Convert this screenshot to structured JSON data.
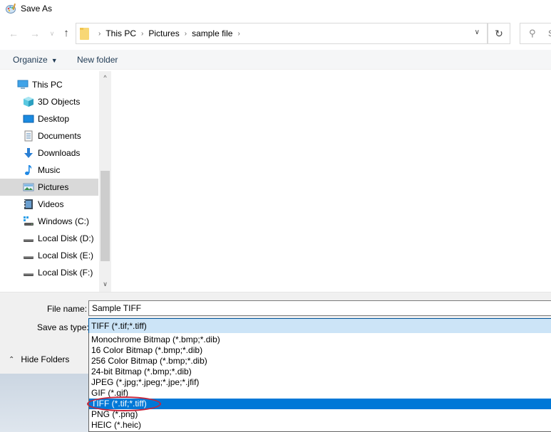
{
  "window": {
    "title": "Save As",
    "app_icon": "paint-palette-icon"
  },
  "navigation": {
    "back_icon": "arrow-left-icon",
    "forward_icon": "arrow-right-icon",
    "recent_icon": "chevron-down-icon",
    "up_icon": "arrow-up-icon",
    "breadcrumb": [
      "This PC",
      "Pictures",
      "sample file"
    ],
    "refresh_icon": "refresh-icon",
    "search_placeholder": "S"
  },
  "toolbar": {
    "organize_label": "Organize",
    "new_folder_label": "New folder"
  },
  "nav_pane": {
    "root": {
      "label": "This PC",
      "icon": "computer-icon"
    },
    "items": [
      {
        "label": "3D Objects",
        "icon": "3d-objects-icon",
        "selected": false
      },
      {
        "label": "Desktop",
        "icon": "desktop-icon",
        "selected": false
      },
      {
        "label": "Documents",
        "icon": "documents-icon",
        "selected": false
      },
      {
        "label": "Downloads",
        "icon": "download-icon",
        "selected": false
      },
      {
        "label": "Music",
        "icon": "music-note-icon",
        "selected": false
      },
      {
        "label": "Pictures",
        "icon": "pictures-icon",
        "selected": true
      },
      {
        "label": "Videos",
        "icon": "videos-icon",
        "selected": false
      },
      {
        "label": "Windows (C:)",
        "icon": "windows-drive-icon",
        "selected": false
      },
      {
        "label": "Local Disk (D:)",
        "icon": "drive-icon",
        "selected": false
      },
      {
        "label": "Local Disk (E:)",
        "icon": "drive-icon",
        "selected": false
      },
      {
        "label": "Local Disk (F:)",
        "icon": "drive-icon",
        "selected": false
      }
    ]
  },
  "form": {
    "file_name_label": "File name:",
    "file_name_value": "Sample TIFF",
    "save_as_type_label": "Save as type:",
    "save_as_type_value": "TIFF (*.tif;*.tiff)",
    "hide_folders_label": "Hide Folders"
  },
  "type_options": [
    {
      "label": "Monochrome Bitmap (*.bmp;*.dib)",
      "selected": false
    },
    {
      "label": "16 Color Bitmap (*.bmp;*.dib)",
      "selected": false
    },
    {
      "label": "256 Color Bitmap (*.bmp;*.dib)",
      "selected": false
    },
    {
      "label": "24-bit Bitmap (*.bmp;*.dib)",
      "selected": false
    },
    {
      "label": "JPEG (*.jpg;*.jpeg;*.jpe;*.jfif)",
      "selected": false
    },
    {
      "label": "GIF (*.gif)",
      "selected": false
    },
    {
      "label": "TIFF (*.tif;*.tiff)",
      "selected": true
    },
    {
      "label": "PNG (*.png)",
      "selected": false
    },
    {
      "label": "HEIC (*.heic)",
      "selected": false
    }
  ],
  "annotation": {
    "highlight_color": "#c8243a",
    "highlighted_option": "TIFF (*.tif;*.tiff)"
  },
  "colors": {
    "selection_blue": "#0078d7",
    "select_focus_bg": "#cce4f7"
  }
}
